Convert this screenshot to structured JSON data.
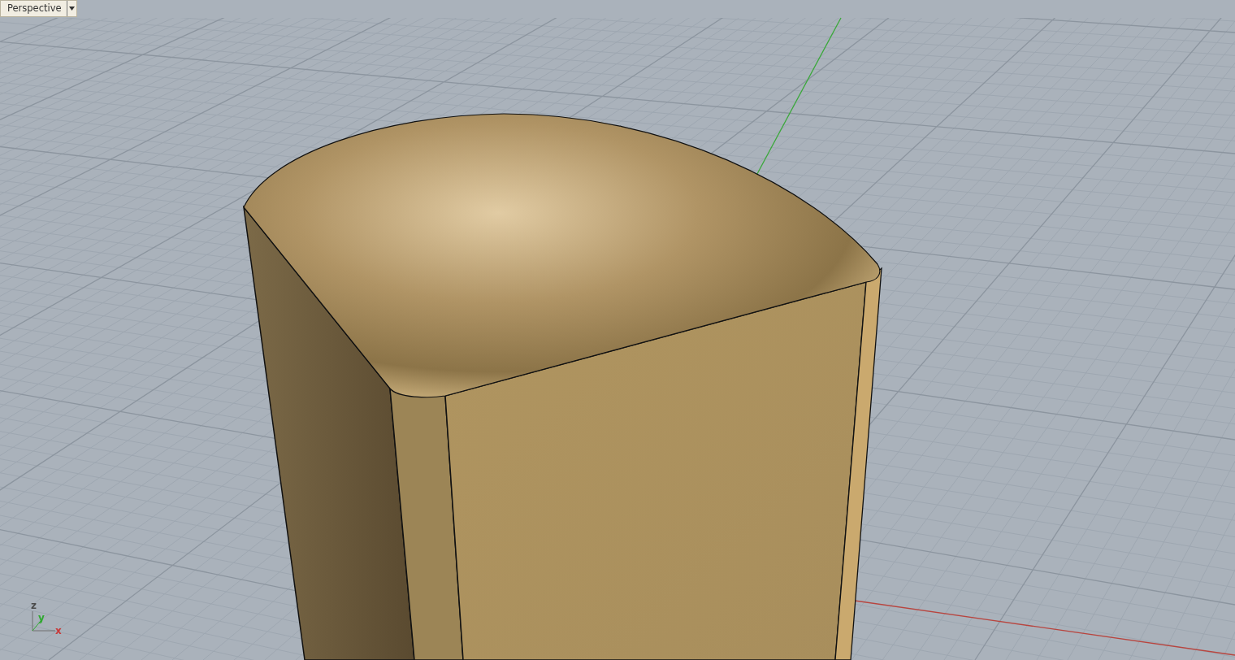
{
  "viewport": {
    "title": "Perspective"
  },
  "axis_labels": [
    {
      "text": "z",
      "color": "#4a4a4a"
    },
    {
      "text": "y",
      "color": "#2fa82f"
    },
    {
      "text": "x",
      "color": "#c83a3a"
    }
  ]
}
